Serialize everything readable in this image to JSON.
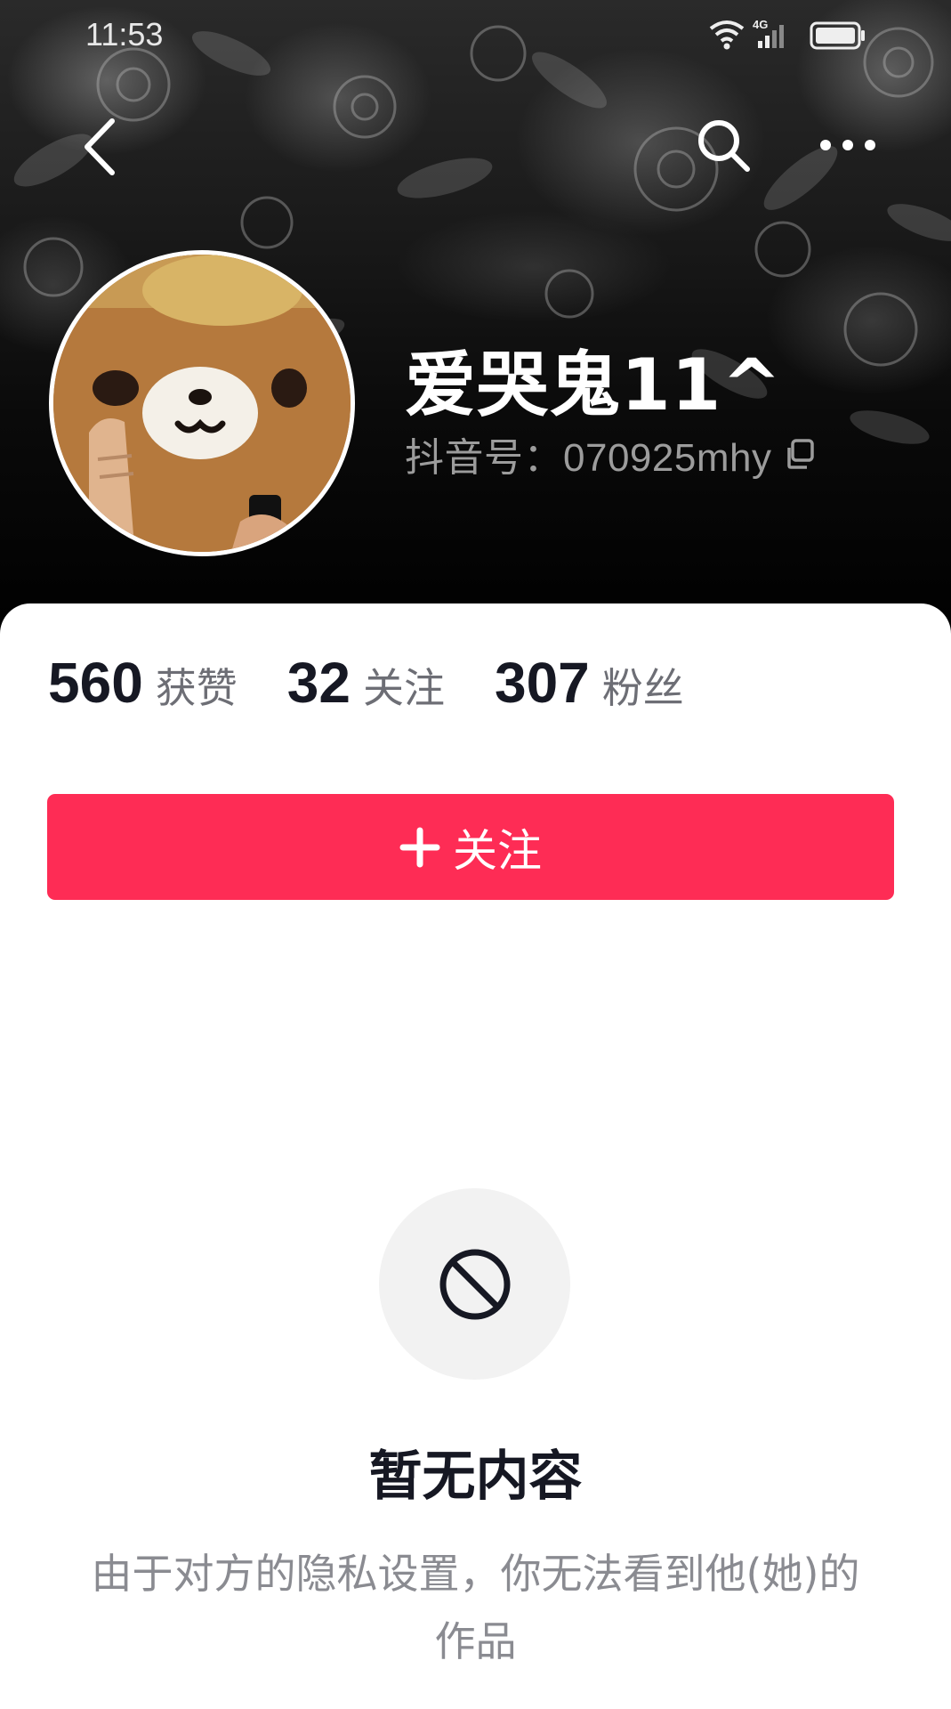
{
  "status_bar": {
    "time": "11:53",
    "network": "4G"
  },
  "header": {
    "back_icon": "chevron-left-icon",
    "search_icon": "search-icon",
    "more_icon": "more-dots-icon"
  },
  "profile": {
    "username": "爱哭鬼11^",
    "douyin_id": "抖音号：070925mhy"
  },
  "stats": [
    {
      "value": "560",
      "label": "获赞"
    },
    {
      "value": "32",
      "label": "关注"
    },
    {
      "value": "307",
      "label": "粉丝"
    }
  ],
  "follow_button": {
    "label": "关注",
    "color": "#fe2c55"
  },
  "empty_state": {
    "icon": "no-entry-icon",
    "title": "暂无内容",
    "description": "由于对方的隐私设置，你无法看到他(她)的作品"
  }
}
